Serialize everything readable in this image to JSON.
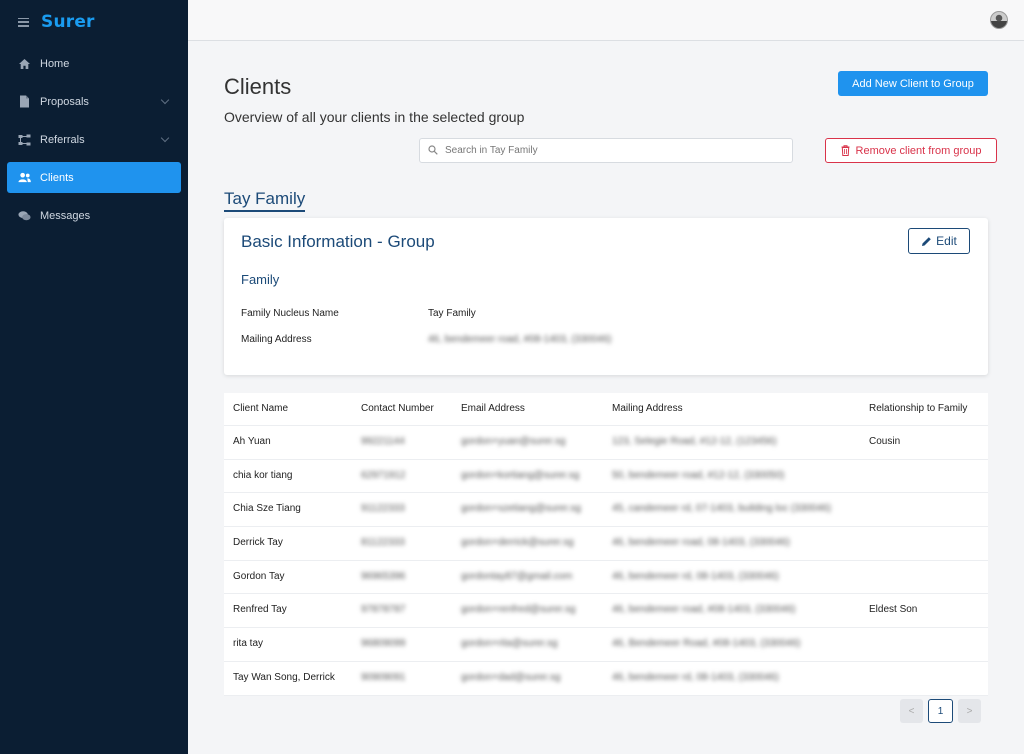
{
  "app": {
    "brand": "Surer"
  },
  "sidebar": {
    "items": [
      {
        "label": "Home",
        "icon": "home-icon",
        "active": false
      },
      {
        "label": "Proposals",
        "icon": "document-icon",
        "active": false
      },
      {
        "label": "Referrals",
        "icon": "referrals-icon",
        "active": false
      },
      {
        "label": "Clients",
        "icon": "users-icon",
        "active": true
      },
      {
        "label": "Messages",
        "icon": "chat-icon",
        "active": false
      }
    ]
  },
  "header": {
    "title": "Clients",
    "subtitle": "Overview of all your clients in the selected group",
    "add_button": "Add New Client to Group",
    "remove_button": "Remove client from group"
  },
  "search": {
    "placeholder": "Search in Tay Family"
  },
  "group": {
    "name": "Tay Family",
    "card_title": "Basic Information - Group",
    "edit_label": "Edit",
    "section": "Family",
    "fields": [
      {
        "label": "Family Nucleus Name",
        "value": "Tay Family"
      },
      {
        "label": "Mailing Address",
        "value": "46, bendemeer road, #08-1403, (330046)"
      }
    ]
  },
  "table": {
    "columns": [
      "Client Name",
      "Contact Number",
      "Email Address",
      "Mailing Address",
      "Relationship to Family"
    ],
    "rows": [
      [
        "Ah Yuan",
        "99221144",
        "gordon+yuan@surer.sg",
        "123, Selegie Road, #12-12, (123456)",
        "Cousin"
      ],
      [
        "chia kor tiang",
        "62971912",
        "gordon+kortiang@surer.sg",
        "50, bendemeer road, #12-12, (330050)",
        ""
      ],
      [
        "Chia Sze Tiang",
        "91122333",
        "gordon+szetiang@surer.sg",
        "45, candemeer rd, 07-1403, building loc (330046)",
        ""
      ],
      [
        "Derrick Tay",
        "81122333",
        "gordon+derrick@surer.sg",
        "46, bendemeer road, 08-1403, (330046)",
        ""
      ],
      [
        "Gordon Tay",
        "96965396",
        "gordontay87@gmail.com",
        "46, bendemeer rd, 08-1403, (330046)",
        ""
      ],
      [
        "Renfred Tay",
        "97878787",
        "gordon+renfred@surer.sg",
        "46, bendemeer road, #08-1403, (330046)",
        "Eldest Son"
      ],
      [
        "rita tay",
        "96809099",
        "gordon+rita@surer.sg",
        "46, Bendemeer Road, #08-1403, (330046)",
        ""
      ],
      [
        "Tay Wan Song, Derrick",
        "90909091",
        "gordon+dad@surer.sg",
        "46, bendemeer rd, 08-1403, (330046)",
        ""
      ]
    ]
  },
  "pagination": {
    "prev": "<",
    "current": "1",
    "next": ">"
  },
  "colors": {
    "sidebar_bg": "#0b1e33",
    "accent": "#1f93ee",
    "danger": "#d9334a",
    "heading": "#1c4a78"
  }
}
